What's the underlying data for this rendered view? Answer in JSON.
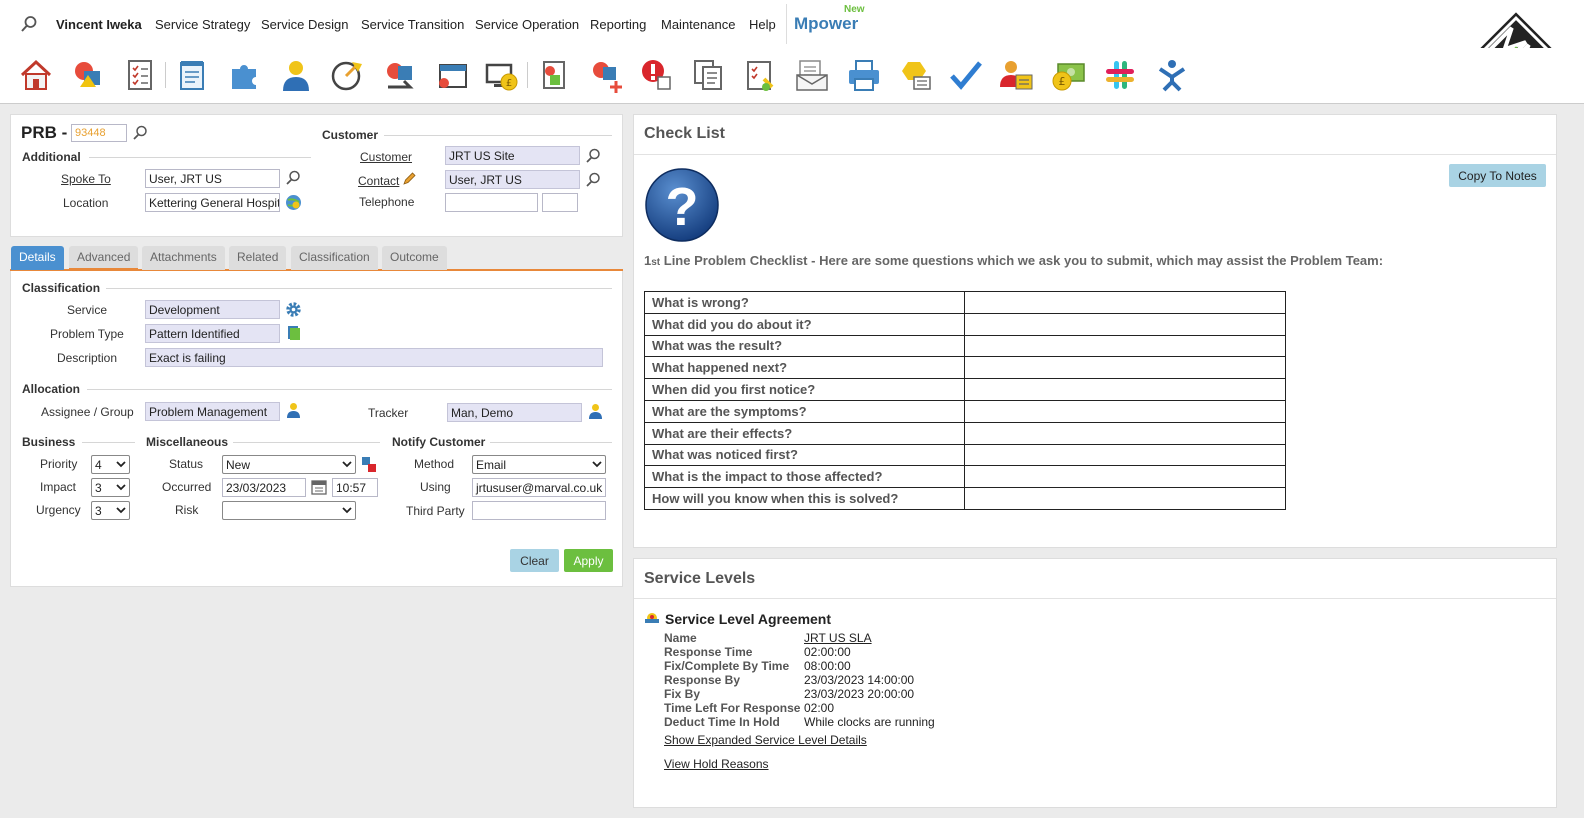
{
  "nav": {
    "user": "Vincent Iweka",
    "menu": [
      "Service Strategy",
      "Service Design",
      "Service Transition",
      "Service Operation",
      "Reporting",
      "Maintenance",
      "Help"
    ],
    "brand_new": "New",
    "brand": "Mpower"
  },
  "toolbar": {
    "icons": [
      "home-icon",
      "problem-icon",
      "checklist-icon",
      "notepad-icon",
      "puzzle-icon",
      "user-icon",
      "speedometer-icon",
      "change-icon",
      "calendar-icon",
      "monitor-cost-icon",
      "document-chart-icon",
      "new-problem-icon",
      "alert-icon",
      "documents-icon",
      "task-checklist-icon",
      "email-icon",
      "printer-icon",
      "knowledge-icon",
      "tick-icon",
      "customer-card-icon",
      "money-icon",
      "slack-icon",
      "jira-icon"
    ]
  },
  "header": {
    "prefix": "PRB -",
    "number": "93448",
    "additional_title": "Additional",
    "spoke_to_label": "Spoke To",
    "spoke_to": "User, JRT US",
    "location_label": "Location",
    "location": "Kettering General Hospital",
    "customer_title": "Customer",
    "customer_label": "Customer",
    "customer": "JRT US Site",
    "contact_label": "Contact",
    "contact": "User, JRT US",
    "telephone_label": "Telephone",
    "telephone": "",
    "telephone_ext": ""
  },
  "tabs": [
    "Details",
    "Advanced",
    "Attachments",
    "Related",
    "Classification",
    "Outcome"
  ],
  "details": {
    "classification_title": "Classification",
    "service_label": "Service",
    "service": "Development",
    "problem_type_label": "Problem Type",
    "problem_type": "Pattern Identified",
    "description_label": "Description",
    "description": "Exact is failing",
    "allocation_title": "Allocation",
    "assignee_label": "Assignee / Group",
    "assignee": "Problem Management",
    "tracker_label": "Tracker",
    "tracker": "Man, Demo",
    "business_title": "Business",
    "priority_label": "Priority",
    "priority": "4",
    "impact_label": "Impact",
    "impact": "3",
    "urgency_label": "Urgency",
    "urgency": "3",
    "misc_title": "Miscellaneous",
    "status_label": "Status",
    "status": "New",
    "occurred_label": "Occurred",
    "occurred_date": "23/03/2023",
    "occurred_time": "10:57",
    "risk_label": "Risk",
    "risk": "",
    "notify_title": "Notify Customer",
    "method_label": "Method",
    "method": "Email",
    "using_label": "Using",
    "using": "jrtususer@marval.co.uk",
    "third_party_label": "Third Party",
    "third_party": "",
    "clear": "Clear",
    "apply": "Apply"
  },
  "checklist": {
    "title": "Check List",
    "copy_btn": "Copy To Notes",
    "intro_num": "1",
    "intro_sup": "st",
    "intro": " Line Problem Checklist - Here are some questions which we ask you to submit, which may assist the Problem Team:",
    "questions": [
      "What is wrong?",
      "What did you do about it?",
      "What was the result?",
      "What happened next?",
      "When did you first notice?",
      "What are the symptoms?",
      "What are their effects?",
      "What was noticed first?",
      "What is the impact to those affected?",
      "How will you know when this is solved?"
    ]
  },
  "service_levels": {
    "title": "Service Levels",
    "sla_title": "Service Level Agreement",
    "rows": [
      {
        "k": "Name",
        "v": "JRT US SLA"
      },
      {
        "k": "Response Time",
        "v": "02:00:00"
      },
      {
        "k": "Fix/Complete By Time",
        "v": "08:00:00"
      },
      {
        "k": "Response By",
        "v": "23/03/2023 14:00:00"
      },
      {
        "k": "Fix By",
        "v": "23/03/2023 20:00:00"
      },
      {
        "k": "Time Left For Response",
        "v": "02:00"
      },
      {
        "k": "Deduct Time In Hold",
        "v": "While clocks are running"
      }
    ],
    "expanded_link": "Show Expanded Service Level Details",
    "hold_link": "View Hold Reasons"
  },
  "colors": {
    "tab_active": "#4a90d0",
    "apply": "#6cbf3f",
    "clear": "#a9d3e4",
    "readonly_field": "#e4e4f4",
    "number": "#e8a030"
  }
}
